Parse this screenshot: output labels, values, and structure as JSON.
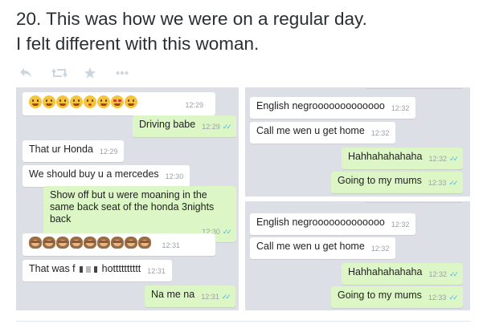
{
  "headline": {
    "line1": "20. This was how we were on a regular day.",
    "line2": "I felt different with this woman."
  },
  "actions": [
    {
      "name": "reply-icon",
      "icon": "reply"
    },
    {
      "name": "retweet-icon",
      "icon": "retweet"
    },
    {
      "name": "favorite-icon",
      "icon": "star"
    },
    {
      "name": "more-icon",
      "icon": "ellipsis"
    }
  ],
  "colors": {
    "incoming_bubble": "#ffffff",
    "outgoing_bubble": "#dcf7c5",
    "chat_background": "#dcdfe6",
    "read_check": "#4fb6ec"
  },
  "left_chat": {
    "m0": {
      "time": "12:29"
    },
    "m1": {
      "text": "Driving babe",
      "time": "12:29"
    },
    "m2": {
      "text": "That ur Honda",
      "time": "12:29"
    },
    "m3": {
      "text": "We should buy u a mercedes",
      "time": "12:30"
    },
    "m4": {
      "line1": "Show off but u were moaning in the",
      "line2": "same back seat of the honda 3nights",
      "line3": "back",
      "time": "12:30"
    },
    "m5": {
      "time": "12:31"
    },
    "m6": {
      "text_a": "That was f",
      "text_b": "hotttttttttt",
      "time": "12:31"
    },
    "m7": {
      "text": "Na me na",
      "time": "12:31"
    }
  },
  "right_chat_1": {
    "m1": {
      "text": "English negrooooooooooooo",
      "time": "12:32"
    },
    "m2": {
      "text": "Call me wen u get home",
      "time": "12:32"
    },
    "m3": {
      "text": "Hahhahahahaha",
      "time": "12:32"
    },
    "m4": {
      "text": "Going to my mums",
      "time": "12:33"
    }
  },
  "right_chat_2": {
    "m1": {
      "text": "English negrooooooooooooo",
      "time": "12:32"
    },
    "m2": {
      "text": "Call me wen u get home",
      "time": "12:32"
    },
    "m3": {
      "text": "Hahhahahahaha",
      "time": "12:32"
    },
    "m4": {
      "text": "Going to my mums",
      "time": "12:33"
    }
  }
}
